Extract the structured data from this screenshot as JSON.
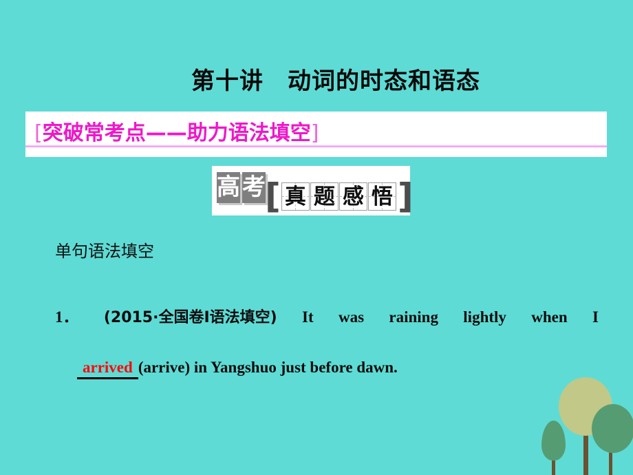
{
  "theme": {
    "background": "#5fdbd5",
    "banner_text_color": "#ef18c9",
    "answer_color": "#fa0a0a",
    "tree_khaki": "#c2c887",
    "tree_green": "#569c72",
    "trunk_brown": "#6b5230"
  },
  "slide": {
    "title": "第十讲　动词的时态和语态",
    "banner": {
      "bracket_open": "[",
      "text": "突破常考点——助力语法填空",
      "bracket_close": "]"
    },
    "logo": {
      "boxed_chars": [
        "高",
        "考"
      ],
      "bracket_open": "[",
      "grid_chars": [
        "真",
        "题",
        "感",
        "悟"
      ],
      "bracket_close": "]",
      "full_text": "高考真题感悟"
    },
    "subheading": "单句语法填空",
    "question": {
      "number": "1．",
      "source": "(2015·全国卷Ⅰ语法填空)",
      "sentence_part1": [
        "It",
        "was",
        "raining",
        "lightly",
        "when",
        "I"
      ],
      "answer": "arrived",
      "sentence_part2": "(arrive) in Yangshuo just before dawn."
    }
  },
  "decoration": {
    "trees": [
      {
        "name": "small-oval-tree",
        "crown_color": "#569c72"
      },
      {
        "name": "large-round-tree",
        "crown_color": "#c2c887"
      },
      {
        "name": "medium-round-tree",
        "crown_color": "#569c72"
      }
    ]
  }
}
